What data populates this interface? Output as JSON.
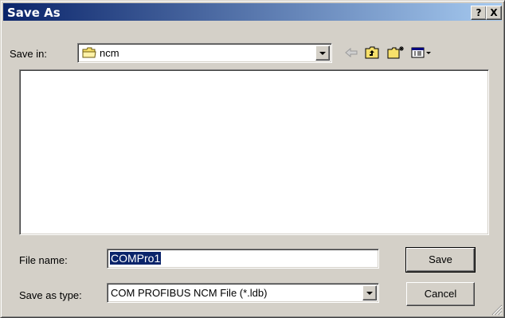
{
  "window": {
    "title": "Save As",
    "help_button": "?",
    "close_button": "X"
  },
  "save_in": {
    "label": "Save in:",
    "value": "ncm"
  },
  "toolbar": {
    "icons": [
      "back-arrow-icon",
      "up-one-level-icon",
      "new-folder-icon",
      "view-menu-icon"
    ]
  },
  "file_name": {
    "label": "File name:",
    "value": "COMPro1"
  },
  "save_as_type": {
    "label": "Save as type:",
    "value": "COM PROFIBUS NCM File (*.ldb)"
  },
  "buttons": {
    "save": "Save",
    "cancel": "Cancel"
  }
}
